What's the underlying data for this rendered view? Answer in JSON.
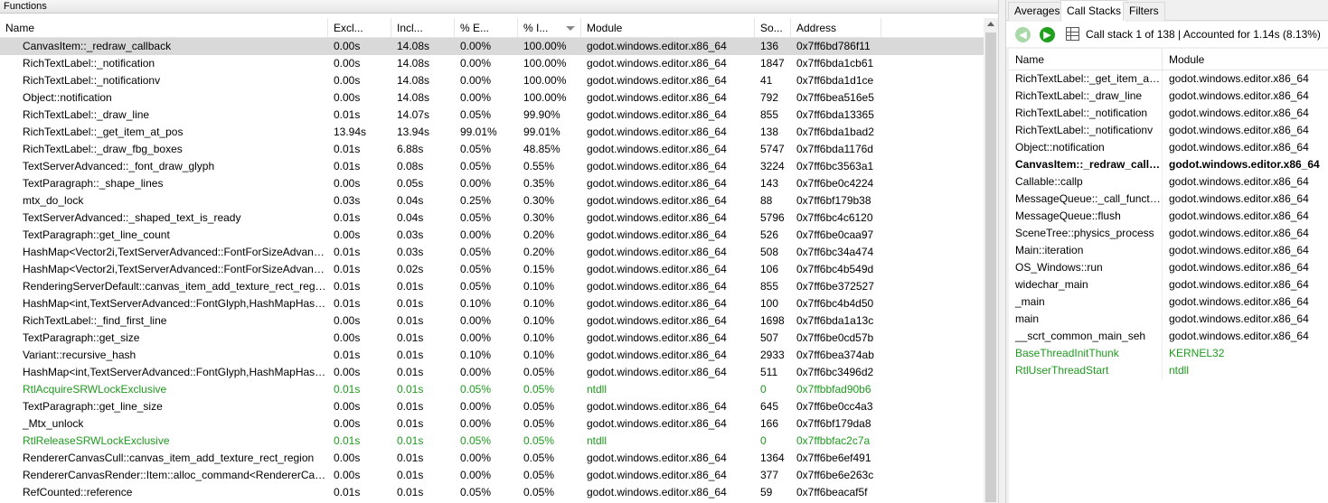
{
  "left_panel": {
    "title": "Functions",
    "columns": {
      "name": "Name",
      "exclusive": "Excl...",
      "inclusive": "Incl...",
      "pct_exclusive": "% E...",
      "pct_inclusive": "% I...",
      "module": "Module",
      "source": "So...",
      "address": "Address"
    },
    "sorted_column": "pct_inclusive",
    "sort_direction": "descending",
    "rows": [
      {
        "name": "CanvasItem::_redraw_callback",
        "excl": "0.00s",
        "incl": "14.08s",
        "pexcl": "0.00%",
        "pincl": "100.00%",
        "module": "godot.windows.editor.x86_64",
        "src": "136",
        "addr": "0x7ff6bd786f11"
      },
      {
        "name": "RichTextLabel::_notification",
        "excl": "0.00s",
        "incl": "14.08s",
        "pexcl": "0.00%",
        "pincl": "100.00%",
        "module": "godot.windows.editor.x86_64",
        "src": "1847",
        "addr": "0x7ff6bda1cb61"
      },
      {
        "name": "RichTextLabel::_notificationv",
        "excl": "0.00s",
        "incl": "14.08s",
        "pexcl": "0.00%",
        "pincl": "100.00%",
        "module": "godot.windows.editor.x86_64",
        "src": "41",
        "addr": "0x7ff6bda1d1ce"
      },
      {
        "name": "Object::notification",
        "excl": "0.00s",
        "incl": "14.08s",
        "pexcl": "0.00%",
        "pincl": "100.00%",
        "module": "godot.windows.editor.x86_64",
        "src": "792",
        "addr": "0x7ff6bea516e5"
      },
      {
        "name": "RichTextLabel::_draw_line",
        "excl": "0.01s",
        "incl": "14.07s",
        "pexcl": "0.05%",
        "pincl": "99.90%",
        "module": "godot.windows.editor.x86_64",
        "src": "855",
        "addr": "0x7ff6bda13365"
      },
      {
        "name": "RichTextLabel::_get_item_at_pos",
        "excl": "13.94s",
        "incl": "13.94s",
        "pexcl": "99.01%",
        "pincl": "99.01%",
        "module": "godot.windows.editor.x86_64",
        "src": "138",
        "addr": "0x7ff6bda1bad2"
      },
      {
        "name": "RichTextLabel::_draw_fbg_boxes",
        "excl": "0.01s",
        "incl": "6.88s",
        "pexcl": "0.05%",
        "pincl": "48.85%",
        "module": "godot.windows.editor.x86_64",
        "src": "5747",
        "addr": "0x7ff6bda1176d"
      },
      {
        "name": "TextServerAdvanced::_font_draw_glyph",
        "excl": "0.01s",
        "incl": "0.08s",
        "pexcl": "0.05%",
        "pincl": "0.55%",
        "module": "godot.windows.editor.x86_64",
        "src": "3224",
        "addr": "0x7ff6bc3563a1"
      },
      {
        "name": "TextParagraph::_shape_lines",
        "excl": "0.00s",
        "incl": "0.05s",
        "pexcl": "0.00%",
        "pincl": "0.35%",
        "module": "godot.windows.editor.x86_64",
        "src": "143",
        "addr": "0x7ff6be0c4224"
      },
      {
        "name": "mtx_do_lock",
        "excl": "0.03s",
        "incl": "0.04s",
        "pexcl": "0.25%",
        "pincl": "0.30%",
        "module": "godot.windows.editor.x86_64",
        "src": "88",
        "addr": "0x7ff6bf179b38"
      },
      {
        "name": "TextServerAdvanced::_shaped_text_is_ready",
        "excl": "0.01s",
        "incl": "0.04s",
        "pexcl": "0.05%",
        "pincl": "0.30%",
        "module": "godot.windows.editor.x86_64",
        "src": "5796",
        "addr": "0x7ff6bc4c6120"
      },
      {
        "name": "TextParagraph::get_line_count",
        "excl": "0.00s",
        "incl": "0.03s",
        "pexcl": "0.00%",
        "pincl": "0.20%",
        "module": "godot.windows.editor.x86_64",
        "src": "526",
        "addr": "0x7ff6be0caa97"
      },
      {
        "name": "HashMap<Vector2i,TextServerAdvanced::FontForSizeAdvance...",
        "excl": "0.01s",
        "incl": "0.03s",
        "pexcl": "0.05%",
        "pincl": "0.20%",
        "module": "godot.windows.editor.x86_64",
        "src": "508",
        "addr": "0x7ff6bc34a474"
      },
      {
        "name": "HashMap<Vector2i,TextServerAdvanced::FontForSizeAdvance...",
        "excl": "0.01s",
        "incl": "0.02s",
        "pexcl": "0.05%",
        "pincl": "0.15%",
        "module": "godot.windows.editor.x86_64",
        "src": "106",
        "addr": "0x7ff6bc4b549d"
      },
      {
        "name": "RenderingServerDefault::canvas_item_add_texture_rect_region",
        "excl": "0.01s",
        "incl": "0.01s",
        "pexcl": "0.05%",
        "pincl": "0.10%",
        "module": "godot.windows.editor.x86_64",
        "src": "855",
        "addr": "0x7ff6be372527"
      },
      {
        "name": "HashMap<int,TextServerAdvanced::FontGlyph,HashMapHash...",
        "excl": "0.01s",
        "incl": "0.01s",
        "pexcl": "0.10%",
        "pincl": "0.10%",
        "module": "godot.windows.editor.x86_64",
        "src": "100",
        "addr": "0x7ff6bc4b4d50"
      },
      {
        "name": "RichTextLabel::_find_first_line",
        "excl": "0.00s",
        "incl": "0.01s",
        "pexcl": "0.00%",
        "pincl": "0.10%",
        "module": "godot.windows.editor.x86_64",
        "src": "1698",
        "addr": "0x7ff6bda1a13c"
      },
      {
        "name": "TextParagraph::get_size",
        "excl": "0.00s",
        "incl": "0.01s",
        "pexcl": "0.00%",
        "pincl": "0.10%",
        "module": "godot.windows.editor.x86_64",
        "src": "507",
        "addr": "0x7ff6be0cd57b"
      },
      {
        "name": "Variant::recursive_hash",
        "excl": "0.01s",
        "incl": "0.01s",
        "pexcl": "0.10%",
        "pincl": "0.10%",
        "module": "godot.windows.editor.x86_64",
        "src": "2933",
        "addr": "0x7ff6bea374ab"
      },
      {
        "name": "HashMap<int,TextServerAdvanced::FontGlyph,HashMapHash...",
        "excl": "0.00s",
        "incl": "0.01s",
        "pexcl": "0.00%",
        "pincl": "0.05%",
        "module": "godot.windows.editor.x86_64",
        "src": "511",
        "addr": "0x7ff6bc3496d2"
      },
      {
        "name": "RtlAcquireSRWLockExclusive",
        "excl": "0.01s",
        "incl": "0.01s",
        "pexcl": "0.05%",
        "pincl": "0.05%",
        "module": "ntdll",
        "src": "0",
        "addr": "0x7ffbbfad90b6",
        "green": true
      },
      {
        "name": "TextParagraph::get_line_size",
        "excl": "0.00s",
        "incl": "0.01s",
        "pexcl": "0.00%",
        "pincl": "0.05%",
        "module": "godot.windows.editor.x86_64",
        "src": "645",
        "addr": "0x7ff6be0cc4a3"
      },
      {
        "name": "_Mtx_unlock",
        "excl": "0.00s",
        "incl": "0.01s",
        "pexcl": "0.00%",
        "pincl": "0.05%",
        "module": "godot.windows.editor.x86_64",
        "src": "166",
        "addr": "0x7ff6bf179da8"
      },
      {
        "name": "RtlReleaseSRWLockExclusive",
        "excl": "0.01s",
        "incl": "0.01s",
        "pexcl": "0.05%",
        "pincl": "0.05%",
        "module": "ntdll",
        "src": "0",
        "addr": "0x7ffbbfac2c7a",
        "green": true
      },
      {
        "name": "RendererCanvasCull::canvas_item_add_texture_rect_region",
        "excl": "0.00s",
        "incl": "0.01s",
        "pexcl": "0.00%",
        "pincl": "0.05%",
        "module": "godot.windows.editor.x86_64",
        "src": "1364",
        "addr": "0x7ff6be6ef491"
      },
      {
        "name": "RendererCanvasRender::Item::alloc_command<RendererCanv...",
        "excl": "0.00s",
        "incl": "0.01s",
        "pexcl": "0.00%",
        "pincl": "0.05%",
        "module": "godot.windows.editor.x86_64",
        "src": "377",
        "addr": "0x7ff6be6e263c"
      },
      {
        "name": "RefCounted::reference",
        "excl": "0.01s",
        "incl": "0.01s",
        "pexcl": "0.05%",
        "pincl": "0.05%",
        "module": "godot.windows.editor.x86_64",
        "src": "59",
        "addr": "0x7ff6beacaf5f"
      }
    ]
  },
  "right_panel": {
    "tabs": [
      "Averages",
      "Call Stacks",
      "Filters"
    ],
    "active_tab": "Call Stacks",
    "status": "Call stack 1 of 138 | Accounted for 1.14s (8.13%)",
    "columns": {
      "name": "Name",
      "module": "Module"
    },
    "stack": [
      {
        "name": "RichTextLabel::_get_item_at_...",
        "module": "godot.windows.editor.x86_64"
      },
      {
        "name": "RichTextLabel::_draw_line",
        "module": "godot.windows.editor.x86_64"
      },
      {
        "name": "RichTextLabel::_notification",
        "module": "godot.windows.editor.x86_64"
      },
      {
        "name": "RichTextLabel::_notificationv",
        "module": "godot.windows.editor.x86_64"
      },
      {
        "name": "Object::notification",
        "module": "godot.windows.editor.x86_64"
      },
      {
        "name": "CanvasItem::_redraw_callb...",
        "module": "godot.windows.editor.x86_64",
        "bold": true
      },
      {
        "name": "Callable::callp",
        "module": "godot.windows.editor.x86_64"
      },
      {
        "name": "MessageQueue::_call_function",
        "module": "godot.windows.editor.x86_64"
      },
      {
        "name": "MessageQueue::flush",
        "module": "godot.windows.editor.x86_64"
      },
      {
        "name": "SceneTree::physics_process",
        "module": "godot.windows.editor.x86_64"
      },
      {
        "name": "Main::iteration",
        "module": "godot.windows.editor.x86_64"
      },
      {
        "name": "OS_Windows::run",
        "module": "godot.windows.editor.x86_64"
      },
      {
        "name": "widechar_main",
        "module": "godot.windows.editor.x86_64"
      },
      {
        "name": "_main",
        "module": "godot.windows.editor.x86_64"
      },
      {
        "name": "main",
        "module": "godot.windows.editor.x86_64"
      },
      {
        "name": "__scrt_common_main_seh",
        "module": "godot.windows.editor.x86_64"
      },
      {
        "name": "BaseThreadInitThunk",
        "module": "KERNEL32",
        "green": true
      },
      {
        "name": "RtlUserThreadStart",
        "module": "ntdll",
        "green": true
      }
    ]
  },
  "colors": {
    "green_text": "#1e9a1e",
    "selected_row": "#d9d9d9",
    "nav_forward": "#1fa01f",
    "nav_back": "#a9d9a9"
  },
  "icons": {
    "back": "arrow-left-icon",
    "forward": "arrow-right-icon",
    "grid": "grid-icon",
    "sort": "sort-desc-icon"
  }
}
